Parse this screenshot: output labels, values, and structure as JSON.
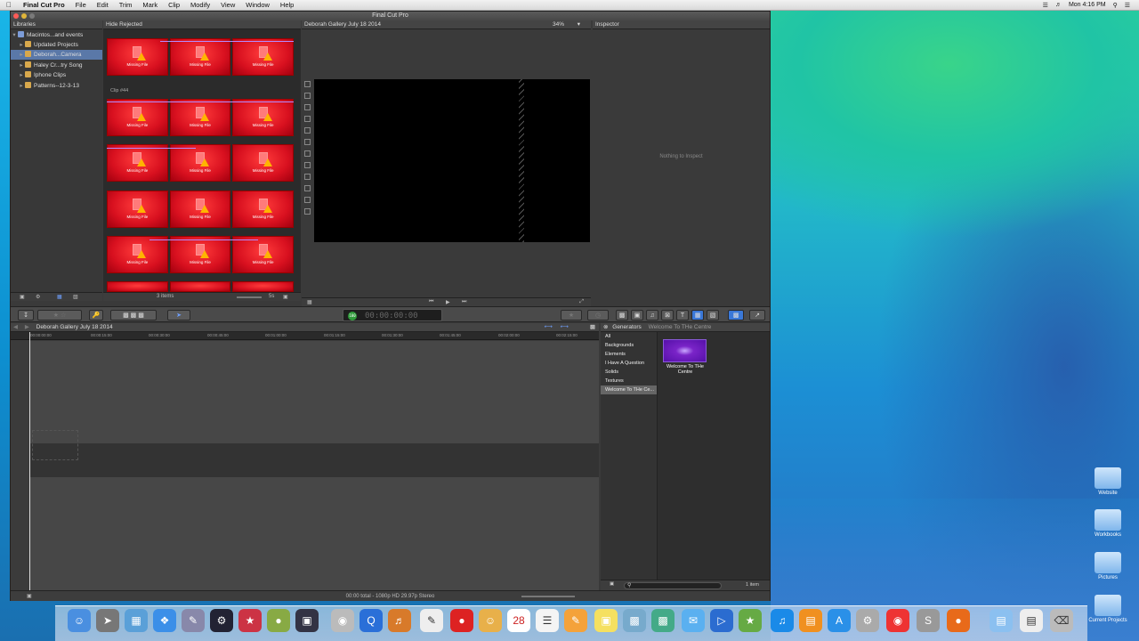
{
  "menubar": {
    "app": "Final Cut Pro",
    "items": [
      "File",
      "Edit",
      "Trim",
      "Mark",
      "Clip",
      "Modify",
      "View",
      "Window",
      "Help"
    ],
    "clock": "Mon 4:16 PM"
  },
  "window": {
    "title": "Final Cut Pro"
  },
  "libraries": {
    "header": "Libraries",
    "items": [
      {
        "label": "Macintos...and events"
      },
      {
        "label": "Updated Projects"
      },
      {
        "label": "Deborah...Camera"
      },
      {
        "label": "Haley Cr...try Song"
      },
      {
        "label": "Iphone Clips"
      },
      {
        "label": "Patterns--12-3-13"
      }
    ]
  },
  "browser": {
    "filter": "Hide Rejected",
    "clip_label": "Clip #44",
    "thumb_text": "Missing File",
    "item_count": "3 items",
    "duration": "5s"
  },
  "viewer": {
    "title": "Deborah Gallery July 18 2014",
    "zoom": "34%"
  },
  "inspector": {
    "header": "Inspector",
    "empty": "Nothing to Inspect"
  },
  "toolbar": {
    "timecode": "00:00:00:00",
    "timecode_badge": "100"
  },
  "timeline": {
    "title": "Deborah Gallery July 18 2014",
    "ticks": [
      "00:00:00:00",
      "00:00:15:00",
      "00:00:30:00",
      "00:00:45:00",
      "00:01:00:00",
      "00:01:15:00",
      "00:01:30:00",
      "00:01:45:00",
      "00:02:00:00",
      "00:02:15:00"
    ]
  },
  "generators": {
    "header": "Generators",
    "breadcrumb": "Welcome To THe Centre",
    "categories": [
      "All",
      "Backgrounds",
      "Elements",
      "I Have A Question",
      "Solids",
      "Textures",
      "Welcome To THe Ce..."
    ],
    "item_name": "Welcome To THe Centre",
    "item_count": "1 item"
  },
  "status": {
    "text": "00:00 total - 1080p HD 29.97p Stereo"
  },
  "desktop": {
    "icons": [
      "Website",
      "Workbooks",
      "Pictures",
      "Current Projects"
    ]
  }
}
